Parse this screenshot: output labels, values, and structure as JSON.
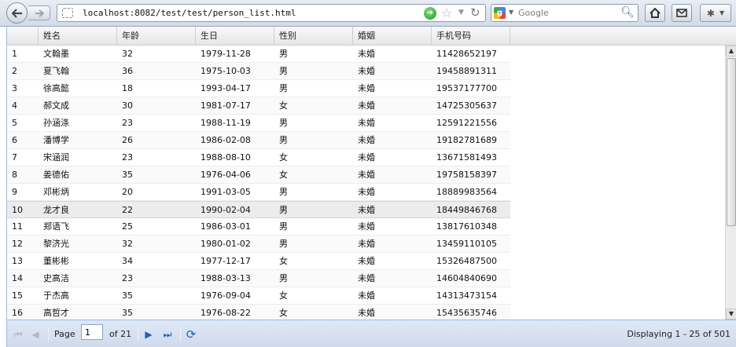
{
  "browser": {
    "url": "localhost:8082/test/test/person_list.html",
    "search_placeholder": "Google"
  },
  "columns": [
    "",
    "姓名",
    "年龄",
    "生日",
    "性别",
    "婚姻",
    "手机号码"
  ],
  "rows": [
    [
      "1",
      "文翰墨",
      "32",
      "1979-11-28",
      "男",
      "未婚",
      "11428652197"
    ],
    [
      "2",
      "夏飞翰",
      "36",
      "1975-10-03",
      "男",
      "未婚",
      "19458891311"
    ],
    [
      "3",
      "徐高懿",
      "18",
      "1993-04-17",
      "男",
      "未婚",
      "19537177700"
    ],
    [
      "4",
      "郝文成",
      "30",
      "1981-07-17",
      "女",
      "未婚",
      "14725305637"
    ],
    [
      "5",
      "孙涵涤",
      "23",
      "1988-11-19",
      "男",
      "未婚",
      "12591221556"
    ],
    [
      "6",
      "潘博学",
      "26",
      "1986-02-08",
      "男",
      "未婚",
      "19182781689"
    ],
    [
      "7",
      "宋涵润",
      "23",
      "1988-08-10",
      "女",
      "未婚",
      "13671581493"
    ],
    [
      "8",
      "姜德佑",
      "35",
      "1976-04-06",
      "女",
      "未婚",
      "19758158397"
    ],
    [
      "9",
      "邓彬炳",
      "20",
      "1991-03-05",
      "男",
      "未婚",
      "18889983564"
    ],
    [
      "10",
      "龙才良",
      "22",
      "1990-02-04",
      "男",
      "未婚",
      "18449846768"
    ],
    [
      "11",
      "郑语飞",
      "25",
      "1986-03-01",
      "男",
      "未婚",
      "13817610348"
    ],
    [
      "12",
      "黎济光",
      "32",
      "1980-01-02",
      "男",
      "未婚",
      "13459110105"
    ],
    [
      "13",
      "董彬彬",
      "34",
      "1977-12-17",
      "女",
      "未婚",
      "15326487500"
    ],
    [
      "14",
      "史高洁",
      "23",
      "1988-03-13",
      "男",
      "未婚",
      "14604840690"
    ],
    [
      "15",
      "于杰高",
      "35",
      "1976-09-04",
      "女",
      "未婚",
      "14313473154"
    ],
    [
      "16",
      "高哲才",
      "35",
      "1976-08-22",
      "女",
      "未婚",
      "15435635746"
    ]
  ],
  "selected_row_index": 9,
  "paging": {
    "page_label": "Page",
    "current_page": "1",
    "of_label": "of 21",
    "display_info": "Displaying 1 - 25 of 501"
  },
  "icons": {
    "first": "first-page-icon",
    "prev": "prev-page-icon",
    "next": "next-page-icon",
    "last": "last-page-icon",
    "refresh": "refresh-icon"
  }
}
